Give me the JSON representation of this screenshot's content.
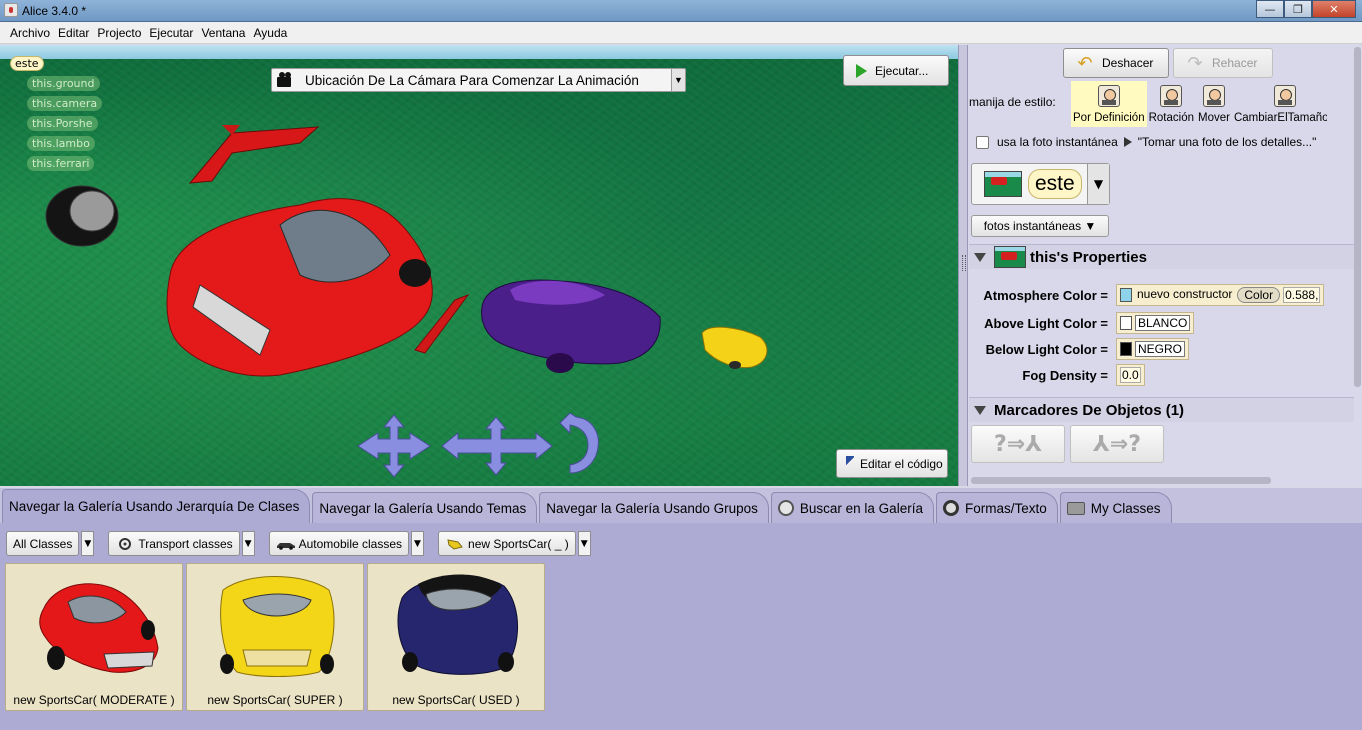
{
  "window": {
    "title": "Alice 3.4.0  *",
    "controls": {
      "minimize": "—",
      "maximize": "❐",
      "close": "✕"
    }
  },
  "menu": [
    "Archivo",
    "Editar",
    "Projecto",
    "Ejecutar",
    "Ventana",
    "Ayuda"
  ],
  "scene": {
    "tree_root": "este",
    "tree_items": [
      "this.ground",
      "this.camera",
      "this.Porshe",
      "this.lambo",
      "this.ferrari"
    ],
    "camera_marker": "Ubicación De La Cámara Para Comenzar La Animación",
    "run_label": "Ejecutar...",
    "edit_code_label": "Editar el código"
  },
  "right_panel": {
    "undo_label": "Deshacer",
    "redo_label": "Rehacer",
    "handle_style_label": "manija de estilo:",
    "handles": [
      {
        "label": "Por Definición",
        "icon": "default-handle-icon",
        "selected": true
      },
      {
        "label": "Rotación",
        "icon": "rotation-handle-icon",
        "selected": false
      },
      {
        "label": "Mover",
        "icon": "move-handle-icon",
        "selected": false
      },
      {
        "label": "CambiarElTamaño",
        "icon": "resize-handle-icon",
        "selected": false
      }
    ],
    "snapshot_checkbox_label": "usa la foto instantánea",
    "snapshot_hint": "\"Tomar una foto de los detalles...\"",
    "selected_instance": "este",
    "snapshots_button": "fotos instantáneas ▼",
    "properties_title": "this's Properties",
    "properties": {
      "atmosphere": {
        "name": "Atmosphere Color =",
        "constructor": "nuevo constructor",
        "class": "Color",
        "value": "0.588,",
        "color": "#8fd3ea"
      },
      "above_light": {
        "name": "Above Light Color =",
        "value": "BLANCO",
        "color": "#ffffff"
      },
      "below_light": {
        "name": "Below Light Color =",
        "value": "NEGRO",
        "color": "#000000"
      },
      "fog": {
        "name": "Fog Density =",
        "value": "0.0"
      }
    },
    "markers_title": "Marcadores De Objetos (1)"
  },
  "gallery": {
    "tabs": [
      {
        "label": "Navegar la Galería Usando Jerarquía De Clases",
        "icon": "",
        "active": true
      },
      {
        "label": "Navegar la Galería Usando Temas",
        "icon": "",
        "active": false
      },
      {
        "label": "Navegar la Galería Usando Grupos",
        "icon": "",
        "active": false
      },
      {
        "label": "Buscar en la Galería",
        "icon": "search-icon",
        "active": false
      },
      {
        "label": "Formas/Texto",
        "icon": "shapes-icon",
        "active": false
      },
      {
        "label": "My Classes",
        "icon": "folder-icon",
        "active": false
      }
    ],
    "breadcrumbs": [
      "All Classes",
      "Transport classes",
      "Automobile classes",
      "new SportsCar( _ )"
    ],
    "cards": [
      {
        "label": "new SportsCar( MODERATE )",
        "color": "#e01818",
        "roof": "#e01818"
      },
      {
        "label": "new SportsCar( SUPER )",
        "color": "#f2d21a",
        "roof": "#f2d21a"
      },
      {
        "label": "new SportsCar( USED )",
        "color": "#2a2a78",
        "roof": "#1a1a1a"
      }
    ]
  }
}
